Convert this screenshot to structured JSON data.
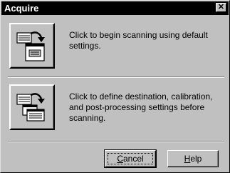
{
  "window": {
    "title": "Acquire"
  },
  "options": [
    {
      "description": "Click to begin scanning using default settings.",
      "icon": "scan-default-icon"
    },
    {
      "description": "Click to define destination, calibration, and post-processing settings before scanning.",
      "icon": "scan-settings-icon"
    }
  ],
  "buttons": {
    "cancel": {
      "label_pre": "",
      "label_mnemonic": "C",
      "label_post": "ancel"
    },
    "help": {
      "label_pre": "",
      "label_mnemonic": "H",
      "label_post": "elp"
    }
  },
  "colors": {
    "dialog_face": "#c0c0c0",
    "titlebar": "#000000"
  }
}
